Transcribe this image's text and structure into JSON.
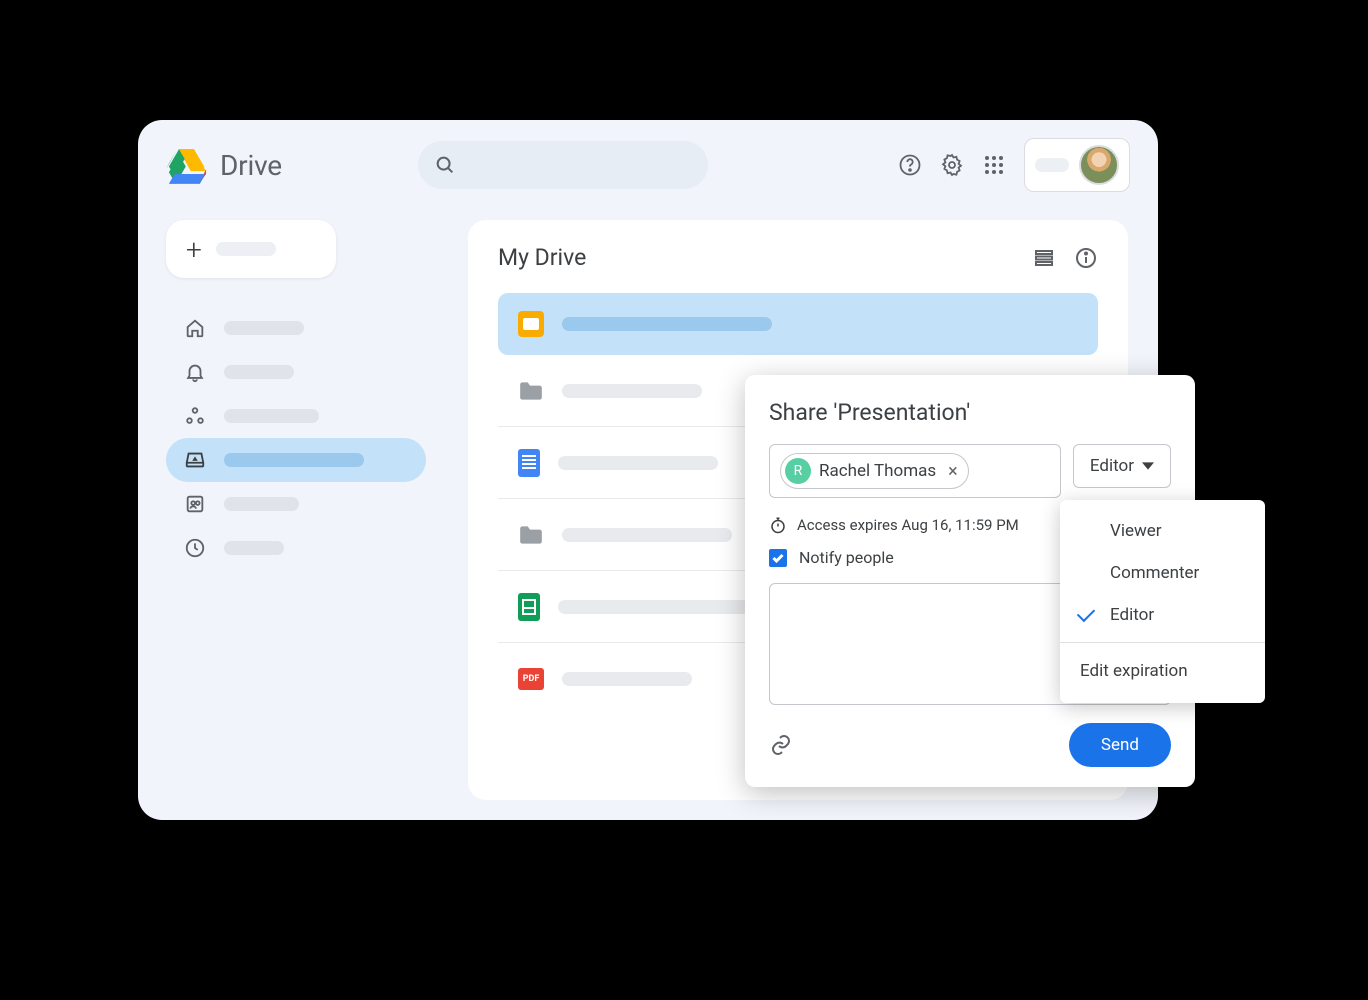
{
  "app": {
    "name": "Drive"
  },
  "main": {
    "title": "My Drive"
  },
  "share": {
    "title": "Share 'Presentation'",
    "person_name": "Rachel Thomas",
    "person_initial": "R",
    "role_selected": "Editor",
    "expire_text": "Access expires Aug 16, 11:59 PM",
    "notify_label": "Notify people",
    "send_label": "Send"
  },
  "role_menu": {
    "options": [
      "Viewer",
      "Commenter",
      "Editor"
    ],
    "selected": "Editor",
    "edit_expiration": "Edit expiration"
  },
  "pdf_label": "PDF"
}
